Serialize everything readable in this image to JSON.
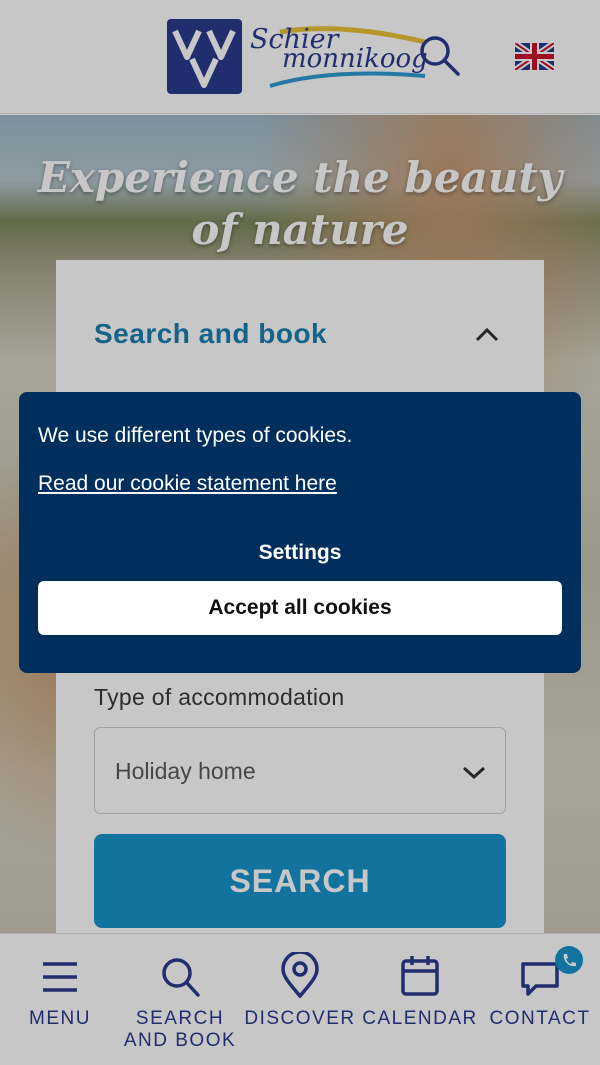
{
  "header": {
    "logo_line1": "Schier",
    "logo_line2": "monnikoog",
    "search_icon": "search-icon",
    "language_flag": "uk-flag-icon"
  },
  "hero": {
    "title": "Experience the beauty of nature"
  },
  "search_panel": {
    "title": "Search and book",
    "accommodation_label": "Type of accommodation",
    "accommodation_value": "Holiday home",
    "search_button": "SEARCH"
  },
  "cookie_banner": {
    "message": "We use different types of cookies.",
    "link": "Read our cookie statement here",
    "settings": "Settings",
    "accept": "Accept all cookies"
  },
  "bottom_nav": {
    "items": [
      {
        "label": "MENU",
        "icon": "menu-icon"
      },
      {
        "label": "SEARCH\nAND BOOK",
        "icon": "search-icon"
      },
      {
        "label": "DISCOVER",
        "icon": "location-pin-icon"
      },
      {
        "label": "CALENDAR",
        "icon": "calendar-icon"
      },
      {
        "label": "CONTACT",
        "icon": "chat-icon"
      }
    ]
  },
  "colors": {
    "brand_navy": "#2a3a8e",
    "accent_blue": "#1894cc",
    "cookie_bg": "#002f5e"
  }
}
